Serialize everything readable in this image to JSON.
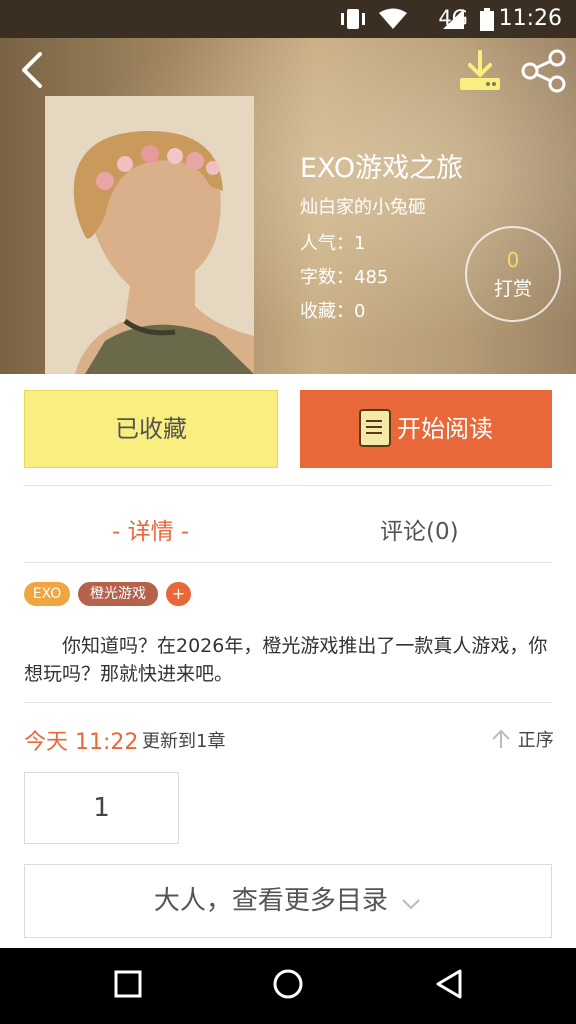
{
  "status_bar": {
    "network": "4G",
    "time": "11:26"
  },
  "book": {
    "title": "EXO游戏之旅",
    "author": "灿白家的小兔砸",
    "popularity": "人气：1",
    "word_count": "字数：485",
    "favorites": "收藏：0"
  },
  "tip": {
    "count": "0",
    "label": "打赏"
  },
  "actions": {
    "collected_label": "已收藏",
    "read_label": "开始阅读"
  },
  "tabs": {
    "detail": "- 详情 -",
    "comments": "评论(0)"
  },
  "tags": [
    {
      "label": "EXO",
      "color": "#f0a640"
    },
    {
      "label": "橙光游戏",
      "color": "#b5614c"
    },
    {
      "label": "+",
      "color": "#e8683a"
    }
  ],
  "description": "你知道吗？在2026年，橙光游戏推出了一款真人游戏，你想玩吗？那就快进来吧。",
  "update": {
    "time": "今天 11:22",
    "text": "更新到1章",
    "order": "正序"
  },
  "chapter": "1",
  "more_label": "大人，查看更多目录",
  "colors": {
    "accent": "#e8683a",
    "collected_bg": "#f8ef80"
  }
}
